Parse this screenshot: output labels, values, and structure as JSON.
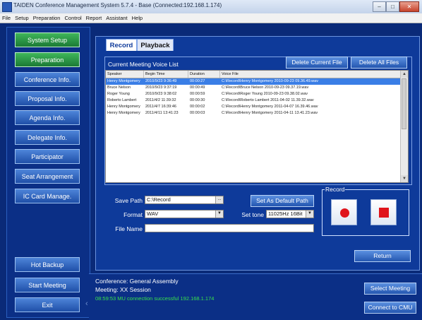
{
  "window": {
    "title": "TAIDEN Conference Management System 5.7.4 - Base (Connected:192.168.1.174)",
    "controls": [
      "–",
      "□",
      "✕"
    ]
  },
  "menu": [
    "File",
    "Setup",
    "Preparation",
    "Control",
    "Report",
    "Assistant",
    "Help"
  ],
  "sidebar": {
    "items": [
      "System Setup",
      "Preparation",
      "Conference Info.",
      "Proposal Info.",
      "Agenda Info.",
      "Delegate Info.",
      "Participator",
      "Seat Arrangement",
      "IC Card Manage."
    ],
    "bottom": [
      "Hot Backup",
      "Start Meeting",
      "Exit"
    ]
  },
  "tabs": [
    "Record",
    "Playback"
  ],
  "voice_list": {
    "caption": "Current Meeting Voice List",
    "delete_current": "Delete Current File",
    "delete_all": "Delete All Files",
    "columns": [
      "Speaker",
      "Begin Time",
      "Duration",
      "Voice File"
    ],
    "rows": [
      [
        "Henry Montgomery",
        "2010/9/23 9:36:49",
        "00:00:27",
        "C:\\Record\\Henry Montgomery 2010-09-23 09.36.49.wav"
      ],
      [
        "Bruce Nelson",
        "2010/9/23 9:37:19",
        "00:00:49",
        "C:\\Record\\Bruce Nelson 2010-09-23 09.37.19.wav"
      ],
      [
        "Roger Young",
        "2010/9/23 9:38:02",
        "00:00:59",
        "C:\\Record\\Roger Young 2010-09-23 09.38.02.wav"
      ],
      [
        "Roberto Lambert",
        "2011/4/2 11:39:32",
        "00:00:30",
        "C:\\Record\\Roberto Lambert 2011-04-02 11.39.32.wav"
      ],
      [
        "Henry Montgomery",
        "2011/4/7 16:39:46",
        "00:00:02",
        "C:\\Record\\Henry Montgomery 2011-04-07 16.39.46.wav"
      ],
      [
        "Henry Montgomery",
        "2011/4/11 13:41:23",
        "00:00:03",
        "C:\\Record\\Henry Montgomery 2011-04-11 13.41.23.wav"
      ]
    ],
    "selected_row": 0
  },
  "form": {
    "save_path_label": "Save Path",
    "save_path_value": "C:\\Record",
    "browse": "...",
    "set_default": "Set As Default Path",
    "format_label": "Format",
    "format_value": "WAV",
    "set_tone_label": "Set tone",
    "set_tone_value": "11025Hz 16Bit",
    "file_name_label": "File Name",
    "file_name_value": ""
  },
  "record_group": {
    "legend": "Record",
    "record_icon": "record-dot-icon",
    "stop_icon": "stop-square-icon"
  },
  "return_label": "Return",
  "status": {
    "conference": "Conference: General Assembly",
    "meeting": "Meeting: XX Session",
    "message": "08:59:53 MU connection successful 192.168.1.174"
  },
  "right_buttons": [
    "Select Meeting",
    "Connect to CMU"
  ],
  "colors": {
    "background": "#0a2a78",
    "panel": "#0e3a9a",
    "accent_green": "#38e14a",
    "record_red": "#e0151c",
    "selected_row": "#3a7ee6"
  }
}
